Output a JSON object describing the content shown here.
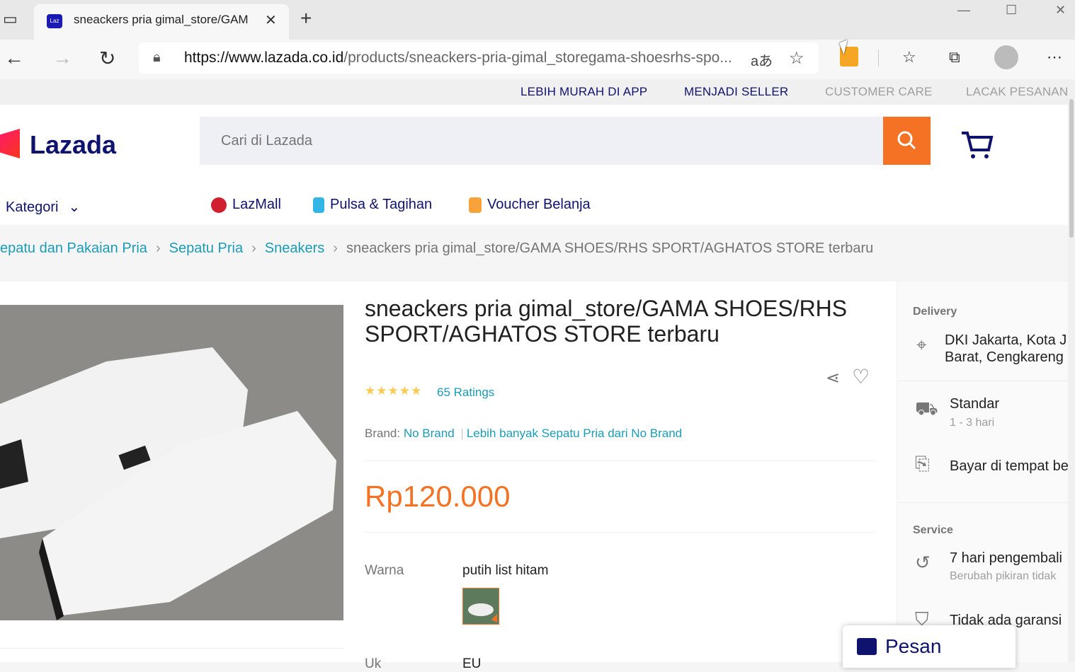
{
  "browser": {
    "tab_title": "sneackers pria gimal_store/GAM",
    "url_host": "https://www.lazada.co.id",
    "url_path": "/products/sneackers-pria-gimal_storegama-shoesrhs-spo...",
    "tab_close": "✕",
    "new_tab": "+"
  },
  "toplinks": [
    "LEBIH MURAH DI APP",
    "MENJADI SELLER",
    "CUSTOMER CARE",
    "LACAK PESANAN"
  ],
  "header": {
    "logo": "Lazada",
    "search_placeholder": "Cari di Lazada"
  },
  "nav": {
    "kategori": "Kategori",
    "items": [
      "LazMall",
      "Pulsa & Tagihan",
      "Voucher Belanja"
    ]
  },
  "breadcrumb": {
    "items": [
      "epatu dan Pakaian Pria",
      "Sepatu Pria",
      "Sneakers"
    ],
    "current": "sneackers pria gimal_store/GAMA SHOES/RHS SPORT/AGHATOS STORE terbaru"
  },
  "product": {
    "title": "sneackers pria gimal_store/GAMA SHOES/RHS SPORT/AGHATOS STORE terbaru",
    "rating_stars": "★★★★★",
    "ratings": "65 Ratings",
    "brand_label": "Brand:",
    "brand": "No Brand",
    "brand_more": "Lebih banyak Sepatu Pria dari No Brand",
    "price": "Rp120.000",
    "warna_label": "Warna",
    "warna_value": "putih list hitam",
    "ukuran_label": "Uk",
    "ukuran_value": "EU"
  },
  "delivery": {
    "heading": "Delivery",
    "location_line1": "DKI Jakarta, Kota J",
    "location_line2": "Barat, Cengkareng",
    "standar": "Standar",
    "standar_time": "1 - 3 hari",
    "bayar": "Bayar di tempat be",
    "service_heading": "Service",
    "retur": "7 hari pengembali",
    "retur_sub": "Berubah pikiran tidak",
    "garansi": "Tidak ada garansi"
  },
  "chat": {
    "label": "Pesan"
  },
  "colors": {
    "accent": "#f57224",
    "link": "#1a9cb7",
    "brand": "#0f136d"
  }
}
